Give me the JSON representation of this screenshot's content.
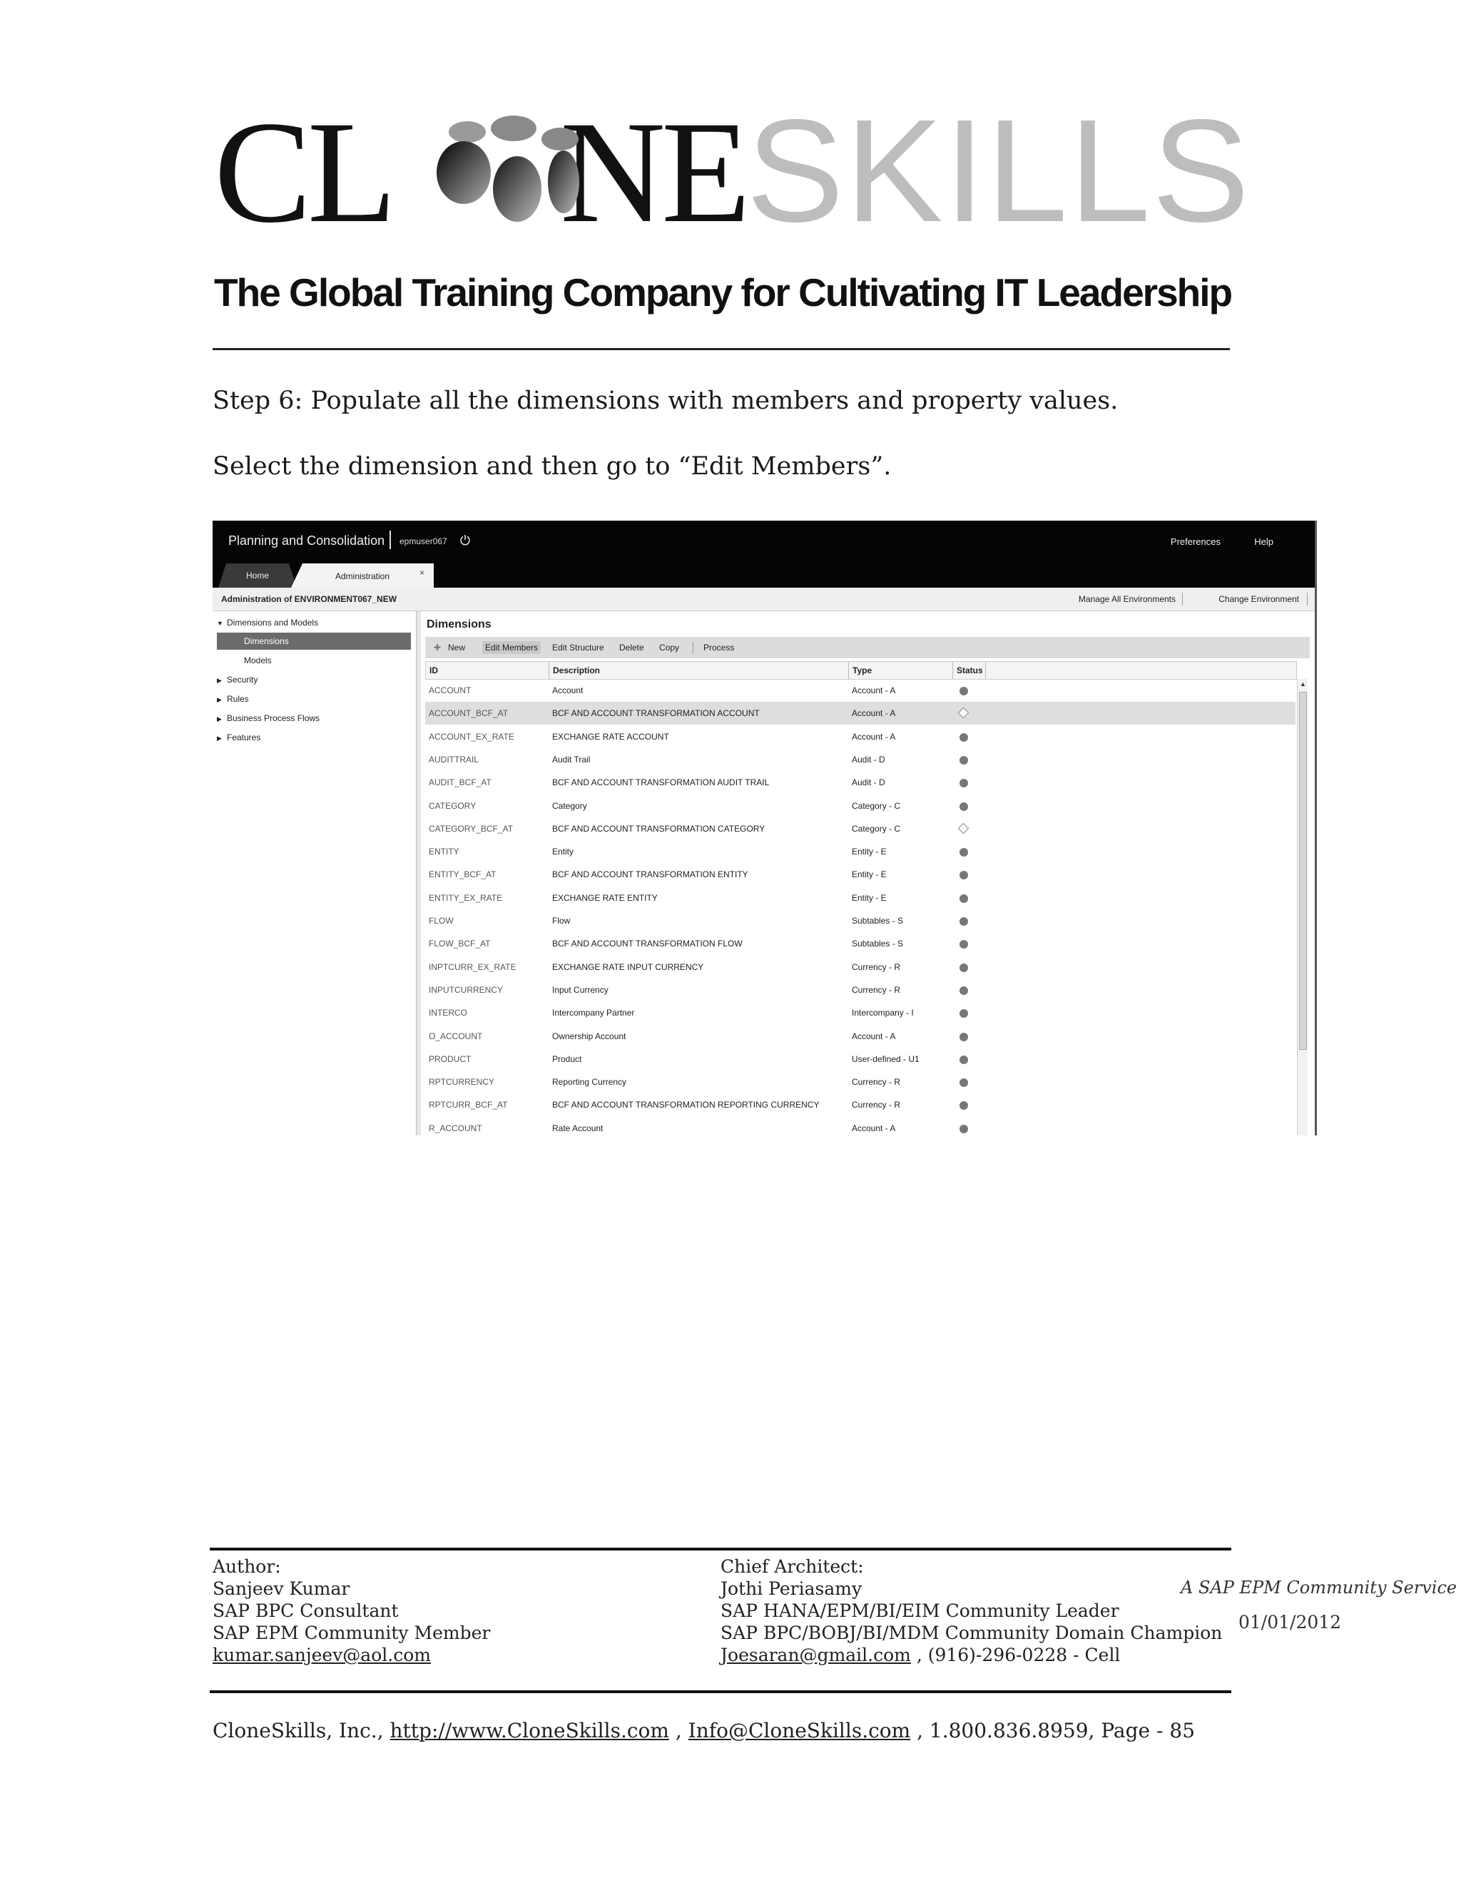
{
  "header": {
    "logo_dark": "CL NE",
    "logo_dark_1": "CL",
    "logo_dark_2": "NE",
    "logo_light": "SKILLS",
    "tagline": "The Global Training Company for Cultivating IT Leadership"
  },
  "instructions": {
    "step": "Step 6: Populate all the dimensions with members and property values.",
    "select": "Select the dimension and then go to “Edit Members”."
  },
  "app": {
    "title": "Planning and Consolidation",
    "user": "epmuser067",
    "preferences": "Preferences",
    "help": "Help",
    "tabs": [
      "Home",
      "Administration"
    ],
    "tab_close": "×",
    "env_title": "Administration of ENVIRONMENT067_NEW",
    "manage_env": "Manage All Environments",
    "change_env": "Change Environment",
    "nav": {
      "dimensions_models": "Dimensions and Models",
      "dimensions": "Dimensions",
      "models": "Models",
      "security": "Security",
      "rules": "Rules",
      "bpf": "Business Process Flows",
      "features": "Features"
    },
    "main_title": "Dimensions",
    "toolbar": {
      "new": "New",
      "edit_members": "Edit Members",
      "edit_structure": "Edit Structure",
      "delete": "Delete",
      "copy": "Copy",
      "process": "Process"
    },
    "columns": [
      "ID",
      "Description",
      "Type",
      "Status"
    ],
    "rows": [
      {
        "id": "ACCOUNT",
        "desc": "Account",
        "type": "Account - A",
        "status": "processed"
      },
      {
        "id": "ACCOUNT_BCF_AT",
        "desc": "BCF AND ACCOUNT TRANSFORMATION ACCOUNT",
        "type": "Account - A",
        "status": "unprocessed"
      },
      {
        "id": "ACCOUNT_EX_RATE",
        "desc": "EXCHANGE RATE ACCOUNT",
        "type": "Account - A",
        "status": "processed"
      },
      {
        "id": "AUDITTRAIL",
        "desc": "Audit Trail",
        "type": "Audit - D",
        "status": "processed"
      },
      {
        "id": "AUDIT_BCF_AT",
        "desc": "BCF AND ACCOUNT TRANSFORMATION AUDIT TRAIL",
        "type": "Audit - D",
        "status": "processed"
      },
      {
        "id": "CATEGORY",
        "desc": "Category",
        "type": "Category - C",
        "status": "processed"
      },
      {
        "id": "CATEGORY_BCF_AT",
        "desc": "BCF AND ACCOUNT TRANSFORMATION CATEGORY",
        "type": "Category - C",
        "status": "unprocessed"
      },
      {
        "id": "ENTITY",
        "desc": "Entity",
        "type": "Entity - E",
        "status": "processed"
      },
      {
        "id": "ENTITY_BCF_AT",
        "desc": "BCF AND ACCOUNT TRANSFORMATION ENTITY",
        "type": "Entity - E",
        "status": "processed"
      },
      {
        "id": "ENTITY_EX_RATE",
        "desc": "EXCHANGE RATE ENTITY",
        "type": "Entity - E",
        "status": "processed"
      },
      {
        "id": "FLOW",
        "desc": "Flow",
        "type": "Subtables - S",
        "status": "processed"
      },
      {
        "id": "FLOW_BCF_AT",
        "desc": "BCF AND ACCOUNT TRANSFORMATION FLOW",
        "type": "Subtables - S",
        "status": "processed"
      },
      {
        "id": "INPTCURR_EX_RATE",
        "desc": "EXCHANGE RATE INPUT CURRENCY",
        "type": "Currency - R",
        "status": "processed"
      },
      {
        "id": "INPUTCURRENCY",
        "desc": "Input Currency",
        "type": "Currency - R",
        "status": "processed"
      },
      {
        "id": "INTERCO",
        "desc": "Intercompany Partner",
        "type": "Intercompany - I",
        "status": "processed"
      },
      {
        "id": "O_ACCOUNT",
        "desc": "Ownership Account",
        "type": "Account - A",
        "status": "processed"
      },
      {
        "id": "PRODUCT",
        "desc": "Product",
        "type": "User-defined - U1",
        "status": "processed"
      },
      {
        "id": "RPTCURRENCY",
        "desc": "Reporting Currency",
        "type": "Currency - R",
        "status": "processed"
      },
      {
        "id": "RPTCURR_BCF_AT",
        "desc": "BCF AND ACCOUNT TRANSFORMATION REPORTING CURRENCY",
        "type": "Currency - R",
        "status": "processed"
      },
      {
        "id": "R_ACCOUNT",
        "desc": "Rate Account",
        "type": "Account - A",
        "status": "processed"
      }
    ],
    "selected_row": 1
  },
  "footer": {
    "author_label": "Author:",
    "author_name": "Sanjeev Kumar",
    "author_role1": "SAP BPC Consultant",
    "author_role2": "SAP EPM Community Member",
    "author_email": "kumar.sanjeev@aol.com",
    "architect_label": "Chief Architect:",
    "architect_name": "Jothi Periasamy",
    "architect_role1": "SAP HANA/EPM/BI/EIM Community Leader",
    "architect_role2": "SAP BPC/BOBJ/BI/MDM Community Domain Champion",
    "architect_email": "Joesaran@gmail.com",
    "architect_phone": " , (916)-296-0228 - Cell",
    "community": "A SAP EPM Community Service",
    "date": "01/01/2012",
    "contact_company": "CloneSkills, Inc., ",
    "contact_url": "http://www.CloneSkills.com",
    "contact_sep": " , ",
    "contact_email": "Info@CloneSkills.com",
    "contact_tail": " , 1.800.836.8959, Page - 85"
  }
}
